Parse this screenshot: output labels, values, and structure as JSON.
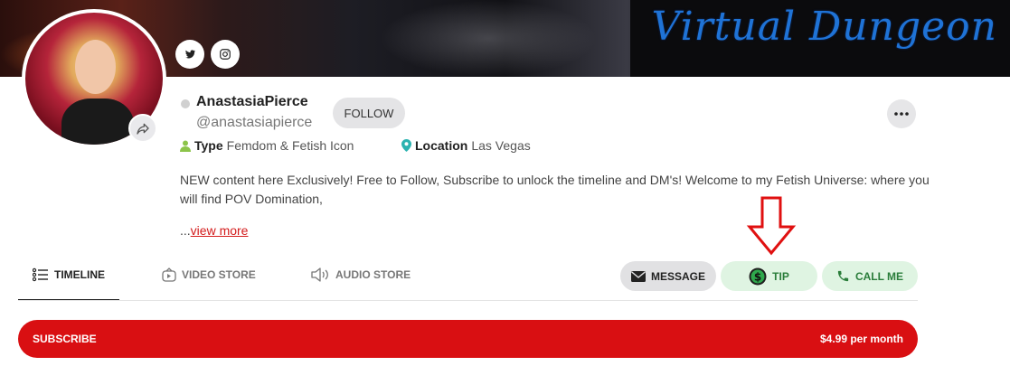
{
  "banner": {
    "title": "Virtual Dungeon"
  },
  "profile": {
    "display_name": "AnastasiaPierce",
    "handle": "@anastasiapierce",
    "follow_label": "FOLLOW",
    "type_label": "Type",
    "type_value": "Femdom & Fetish Icon",
    "location_label": "Location",
    "location_value": "Las Vegas",
    "bio": "NEW content here Exclusively! Free to Follow, Subscribe to unlock the timeline and DM's! Welcome to my Fetish Universe: where you will find POV Domination,",
    "view_more_prefix": "...",
    "view_more_label": "view more"
  },
  "social": {
    "twitter_icon": "twitter-icon",
    "instagram_icon": "instagram-icon"
  },
  "tabs": [
    {
      "label": "TIMELINE",
      "icon": "list-icon",
      "active": true
    },
    {
      "label": "VIDEO STORE",
      "icon": "camera-icon",
      "active": false
    },
    {
      "label": "AUDIO STORE",
      "icon": "speaker-icon",
      "active": false
    }
  ],
  "actions": {
    "message_label": "MESSAGE",
    "tip_label": "TIP",
    "call_label": "CALL ME"
  },
  "subscribe": {
    "label": "SUBSCRIBE",
    "price": "$4.99 per month"
  },
  "colors": {
    "accent_red": "#d90f12",
    "green": "#2a7d3a",
    "banner_blue": "#1f73d6"
  }
}
